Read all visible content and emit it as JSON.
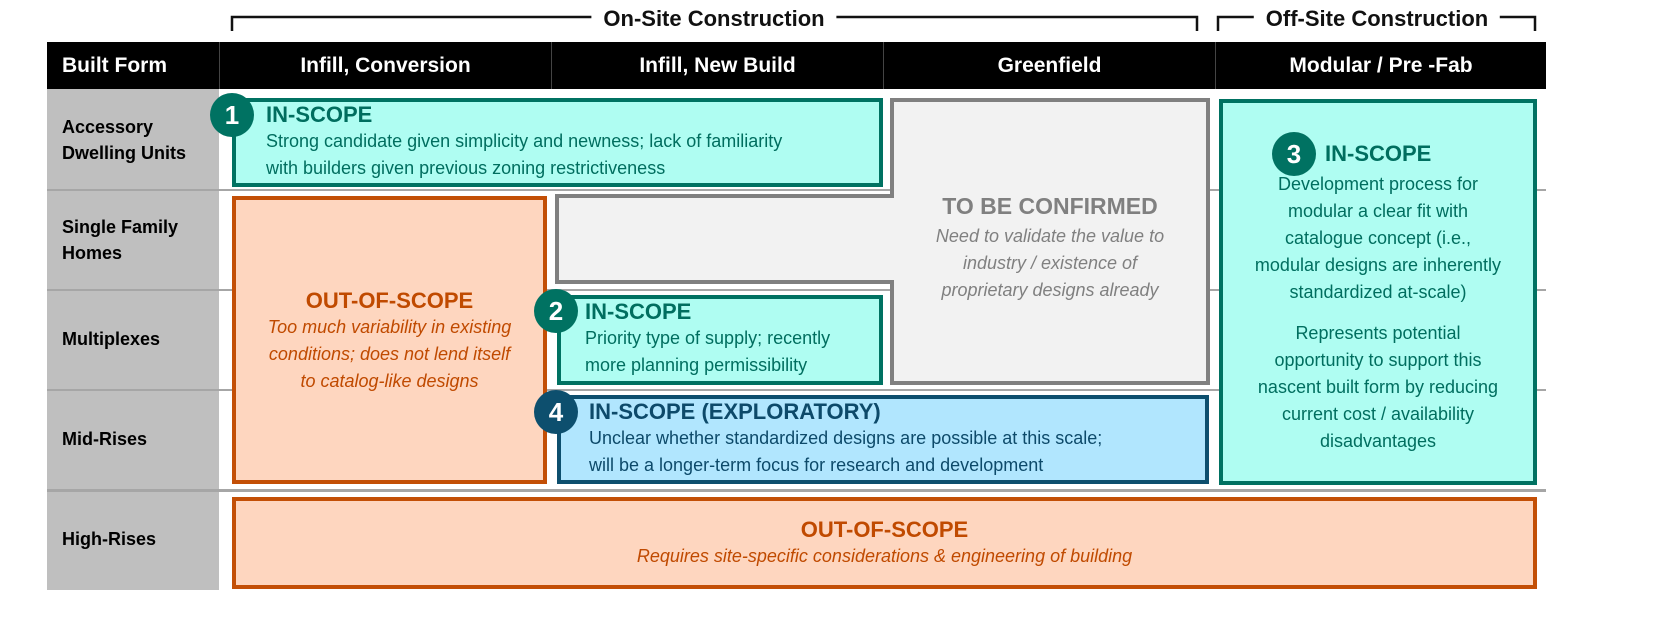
{
  "groups": {
    "on_site": "On-Site Construction",
    "off_site": "Off-Site Construction"
  },
  "header": {
    "columns": [
      "Built Form",
      "Infill, Conversion",
      "Infill, New Build",
      "Greenfield",
      "Modular / Pre -Fab"
    ]
  },
  "rows": [
    {
      "label_line1": "Accessory",
      "label_line2": "Dwelling Units"
    },
    {
      "label_line1": "Single Family",
      "label_line2": "Homes"
    },
    {
      "label_line1": "Multiplexes",
      "label_line2": ""
    },
    {
      "label_line1": "Mid-Rises",
      "label_line2": ""
    },
    {
      "label_line1": "High-Rises",
      "label_line2": ""
    }
  ],
  "boxes": {
    "box1": {
      "number": "1",
      "title": "IN-SCOPE",
      "line1": "Strong candidate given simplicity and newness; lack of familiarity",
      "line2": "with builders given previous zoning restrictiveness"
    },
    "box2": {
      "number": "2",
      "title": "IN-SCOPE",
      "line1": "Priority type of supply; recently",
      "line2": "more planning permissibility"
    },
    "box3": {
      "number": "3",
      "title": "IN-SCOPE",
      "para1": [
        "Development process for",
        "modular a clear fit with",
        "catalogue concept (i.e.,",
        "modular designs are inherently",
        "standardized at-scale)"
      ],
      "para2": [
        "Represents potential",
        "opportunity to support this",
        "nascent built form by reducing",
        "current cost / availability",
        "disadvantages"
      ]
    },
    "box4": {
      "number": "4",
      "title": "IN-SCOPE (EXPLORATORY)",
      "line1": "Unclear whether standardized designs are possible at this scale;",
      "line2": "will be a longer-term focus for research and development"
    },
    "tbc": {
      "title": "TO BE CONFIRMED",
      "lines": [
        "Need to validate the value to",
        "industry / existence of",
        "proprietary designs already"
      ]
    },
    "out_left": {
      "title": "OUT-OF-SCOPE",
      "lines": [
        "Too much variability in existing",
        "conditions; does not lend itself",
        "to catalog-like designs"
      ]
    },
    "out_bottom": {
      "title": "OUT-OF-SCOPE",
      "line": "Requires site-specific considerations & engineering of building"
    }
  },
  "colors": {
    "in_scope_fill": "#affdf2",
    "in_scope_border": "#007262",
    "out_scope_fill": "#fed6bf",
    "out_scope_border": "#c34f06",
    "exploratory_fill": "#b1e6fe",
    "exploratory_border": "#0d4f6e",
    "tbc_fill": "#f2f2f2",
    "tbc_border": "#808080"
  }
}
